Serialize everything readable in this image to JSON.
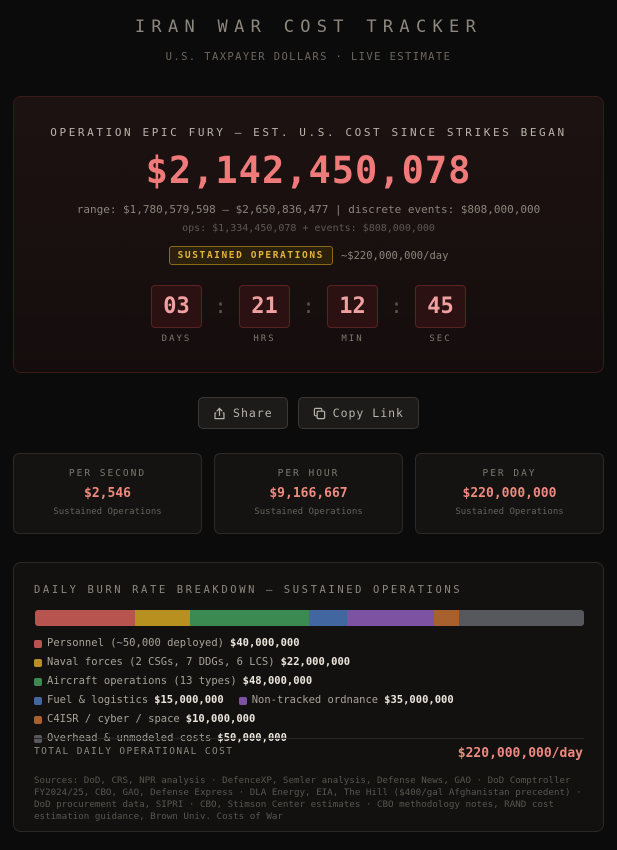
{
  "header": {
    "title": "IRAN WAR COST TRACKER",
    "subtitle": "U.S. TAXPAYER DOLLARS · LIVE ESTIMATE"
  },
  "hero": {
    "label": "OPERATION EPIC FURY — EST. U.S. COST SINCE STRIKES BEGAN",
    "amount": "$2,142,450,078",
    "range": "range: $1,780,579,598 – $2,650,836,477 | discrete events: $808,000,000",
    "ops": "ops: $1,334,450,078 + events: $808,000,000",
    "status_badge": "SUSTAINED OPERATIONS",
    "status_rate": "~$220,000,000/day",
    "countdown": [
      {
        "value": "03",
        "label": "DAYS"
      },
      {
        "value": "21",
        "label": "HRS"
      },
      {
        "value": "12",
        "label": "MIN"
      },
      {
        "value": "45",
        "label": "SEC"
      }
    ],
    "countdown_sep": ":"
  },
  "actions": {
    "share_label": "Share",
    "copy_label": "Copy Link"
  },
  "rates": [
    {
      "label": "PER SECOND",
      "value": "$2,546",
      "sub": "Sustained Operations"
    },
    {
      "label": "PER HOUR",
      "value": "$9,166,667",
      "sub": "Sustained Operations"
    },
    {
      "label": "PER DAY",
      "value": "$220,000,000",
      "sub": "Sustained Operations"
    }
  ],
  "breakdown": {
    "title": "DAILY BURN RATE BREAKDOWN — SUSTAINED OPERATIONS",
    "items": [
      {
        "name": "Personnel (~50,000 deployed)",
        "value": "$40,000,000",
        "amount": 40000000,
        "color": "#b85450"
      },
      {
        "name": "Naval forces (2 CSGs, 7 DDGs, 6 LCS)",
        "value": "$22,000,000",
        "amount": 22000000,
        "color": "#b8901f"
      },
      {
        "name": "Aircraft operations (13 types)",
        "value": "$48,000,000",
        "amount": 48000000,
        "color": "#3a8a52"
      },
      {
        "name": "Fuel & logistics",
        "value": "$15,000,000",
        "amount": 15000000,
        "color": "#4267a0"
      },
      {
        "name": "Non-tracked ordnance",
        "value": "$35,000,000",
        "amount": 35000000,
        "color": "#7d52a3"
      },
      {
        "name": "C4ISR / cyber / space",
        "value": "$10,000,000",
        "amount": 10000000,
        "color": "#a8612c"
      },
      {
        "name": "Overhead & unmodeled costs",
        "value": "$50,000,000",
        "amount": 50000000,
        "color": "#56585e"
      }
    ],
    "total_label": "TOTAL DAILY OPERATIONAL COST",
    "total_value": "$220,000,000/day",
    "sources": "Sources: DoD, CRS, NPR analysis · DefenceXP, Semler analysis, Defense News, GAO · DoD Comptroller FY2024/25, CBO, GAO, Defense Express · DLA Energy, EIA, The Hill ($400/gal Afghanistan precedent) · DoD procurement data, SIPRI · CBO, Stimson Center estimates · CBO methodology notes, RAND cost estimation guidance, Brown Univ. Costs of War"
  }
}
